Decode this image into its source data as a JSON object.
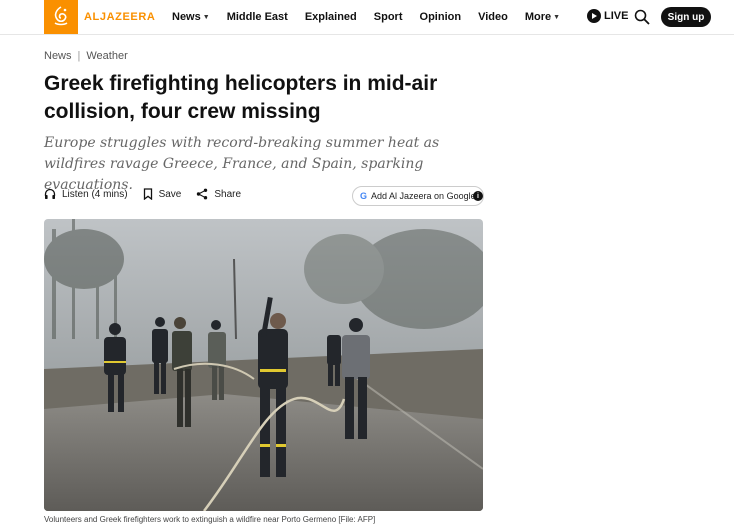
{
  "header": {
    "logo_text": "ALJAZEERA",
    "nav": [
      {
        "label": "News",
        "dropdown": true
      },
      {
        "label": "Middle East",
        "dropdown": false
      },
      {
        "label": "Explained",
        "dropdown": false
      },
      {
        "label": "Sport",
        "dropdown": false
      },
      {
        "label": "Opinion",
        "dropdown": false
      },
      {
        "label": "Video",
        "dropdown": false
      },
      {
        "label": "More",
        "dropdown": true
      }
    ],
    "live_label": "LIVE",
    "signup_label": "Sign up"
  },
  "breadcrumb": {
    "section": "News",
    "subsection": "Weather"
  },
  "article": {
    "title": "Greek firefighting helicopters in mid-air collision, four crew missing",
    "subtitle": "Europe struggles with record-breaking summer heat as wildfires ravage Greece, France, and Spain, sparking evacuations.",
    "actions": {
      "listen": "Listen (4 mins)",
      "save": "Save",
      "share": "Share",
      "google": "Add Al Jazeera on Google"
    },
    "caption": "Volunteers and Greek firefighters work to extinguish a wildfire near Porto Germeno [File: AFP]"
  },
  "colors": {
    "brand": "#fa9000",
    "text": "#111111",
    "subtitle": "#666666"
  }
}
